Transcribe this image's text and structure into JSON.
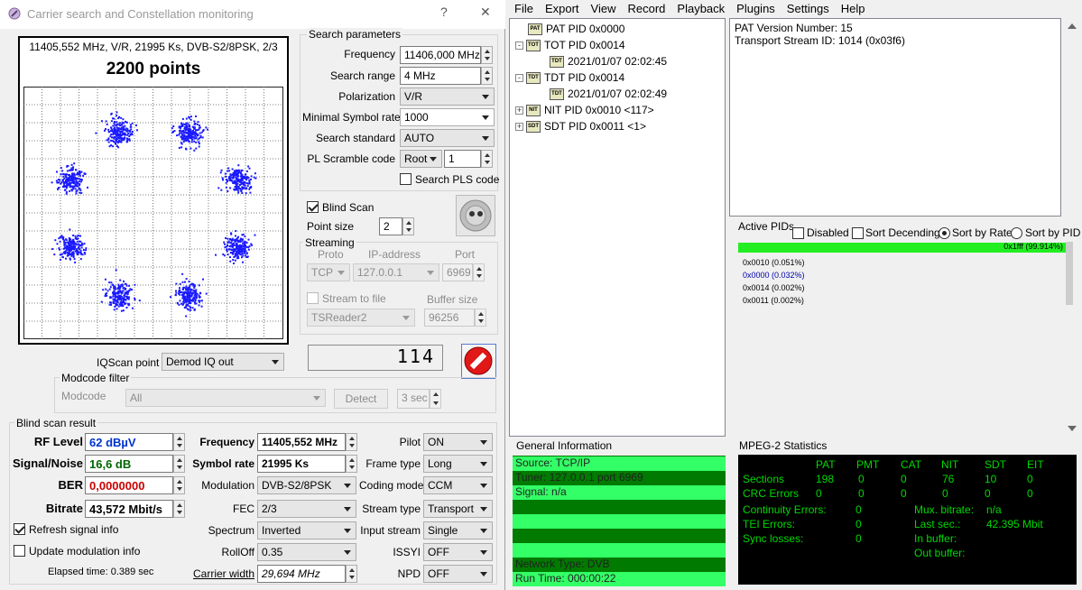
{
  "dialog": {
    "title": "Carrier search and Constellation monitoring",
    "help": "?",
    "close": "✕",
    "constellation": {
      "info": "11405,552 MHz, V/R, 21995 Ks, DVB-S2/8PSK, 2/3",
      "points": "2200 points"
    },
    "search": {
      "group": "Search parameters",
      "frequency_label": "Frequency",
      "frequency": "11406,000 MHz",
      "range_label": "Search range",
      "range": "4 MHz",
      "pol_label": "Polarization",
      "pol": "V/R",
      "msr_label": "Minimal Symbol rate",
      "msr": "1000",
      "std_label": "Search standard",
      "std": "AUTO",
      "pls_label": "PL Scramble code",
      "pls_mode": "Root",
      "pls_value": "1",
      "search_pls": "Search PLS code"
    },
    "blind": {
      "label": "Blind Scan",
      "checked": true
    },
    "point_size_label": "Point size",
    "point_size": "2",
    "streaming": {
      "group": "Streaming",
      "proto_h": "Proto",
      "ip_h": "IP-address",
      "port_h": "Port",
      "proto": "TCP",
      "ip": "127.0.0.1",
      "port": "6969",
      "file_label": "Stream to file",
      "buffer_h": "Buffer size",
      "target": "TSReader2",
      "buffer": "96256"
    },
    "counter": "114",
    "iq_label": "IQScan point",
    "iq": "Demod IQ out",
    "modcode": {
      "group": "Modcode filter",
      "label": "Modcode",
      "value": "All",
      "detect": "Detect",
      "time": "3 sec"
    },
    "result": {
      "group": "Blind scan result",
      "rf_label": "RF Level",
      "rf": "62 dBµV",
      "snr_label": "Signal/Noise",
      "snr": "16,6 dB",
      "ber_label": "BER",
      "ber": "0,0000000",
      "bitrate_label": "Bitrate",
      "bitrate": "43,572 Mbit/s",
      "freq_label": "Frequency",
      "freq": "11405,552 MHz",
      "sr_label": "Symbol rate",
      "sr": "21995 Ks",
      "mod_label": "Modulation",
      "mod": "DVB-S2/8PSK",
      "fec_label": "FEC",
      "fec": "2/3",
      "spec_label": "Spectrum",
      "spec": "Inverted",
      "roll_label": "RollOff",
      "roll": "0.35",
      "cw_label": "Carrier width",
      "cw": "29,694 MHz",
      "pilot_label": "Pilot",
      "pilot": "ON",
      "frame_label": "Frame type",
      "frame": "Long",
      "coding_label": "Coding mode",
      "coding": "CCM",
      "stype_label": "Stream type",
      "stype": "Transport",
      "istream_label": "Input stream",
      "istream": "Single",
      "issyi_label": "ISSYI",
      "issyi": "OFF",
      "npd_label": "NPD",
      "npd": "OFF"
    },
    "refresh": "Refresh signal info",
    "update_mod": "Update modulation info",
    "elapsed": "Elapsed time: 0.389 sec",
    "colors": {
      "rf": "#0033cc",
      "snr": "#006600",
      "ber": "#cc0000"
    }
  },
  "ts": {
    "menu": [
      "File",
      "Export",
      "View",
      "Record",
      "Playback",
      "Plugins",
      "Settings",
      "Help"
    ],
    "tree": [
      {
        "icon": "PAT",
        "label": "PAT PID 0x0000",
        "level": 0,
        "exp": ""
      },
      {
        "icon": "TOT",
        "label": "TOT PID 0x0014",
        "level": 0,
        "exp": "-"
      },
      {
        "icon": "TDT",
        "label": "2021/01/07 02:02:45",
        "level": 1,
        "exp": ""
      },
      {
        "icon": "TDT",
        "label": "TDT PID 0x0014",
        "level": 0,
        "exp": "-"
      },
      {
        "icon": "TDT",
        "label": "2021/01/07 02:02:49",
        "level": 1,
        "exp": ""
      },
      {
        "icon": "NIT",
        "label": "NIT PID 0x0010 <117>",
        "level": 0,
        "exp": "+"
      },
      {
        "icon": "SDT",
        "label": "SDT PID 0x0011 <1>",
        "level": 0,
        "exp": "+"
      }
    ],
    "detail": [
      "PAT Version Number: 15",
      "Transport Stream ID: 1014 (0x03f6)"
    ],
    "pids": {
      "title": "Active PIDs",
      "disabled": "Disabled",
      "sort_desc": "Sort Decending",
      "sort_rate": "Sort by Rate",
      "sort_pid": "Sort by PID",
      "bar": "0x1fff (99.914%)",
      "rows": [
        "0x0010 (0.051%)",
        "0x0000 (0.032%)",
        "0x0014 (0.002%)",
        "0x0011 (0.002%)"
      ]
    },
    "general": {
      "title": "General Information",
      "rows": [
        "Source: TCP/IP",
        "Tuner: 127.0.0.1 port 6969",
        "Signal: n/a",
        "",
        "",
        "",
        "",
        "Network Type: DVB",
        "Run Time: 000:00:22"
      ]
    },
    "mpeg": {
      "title": "MPEG-2 Statistics",
      "heads": [
        "PAT",
        "PMT",
        "CAT",
        "NIT",
        "SDT",
        "EIT"
      ],
      "sections_label": "Sections",
      "sections": [
        "198",
        "0",
        "0",
        "76",
        "10",
        "0"
      ],
      "crc_label": "CRC Errors",
      "crc": [
        "0",
        "0",
        "0",
        "0",
        "0",
        "0"
      ],
      "cont_label": "Continuity Errors:",
      "cont": "0",
      "tei_label": "TEI Errors:",
      "tei": "0",
      "sync_label": "Sync losses:",
      "sync": "0",
      "mux_label": "Mux. bitrate:",
      "mux": "n/a",
      "last_label": "Last sec.:",
      "last": "42.395 Mbit",
      "inbuf_label": "In buffer:",
      "outbuf_label": "Out buffer:"
    }
  }
}
